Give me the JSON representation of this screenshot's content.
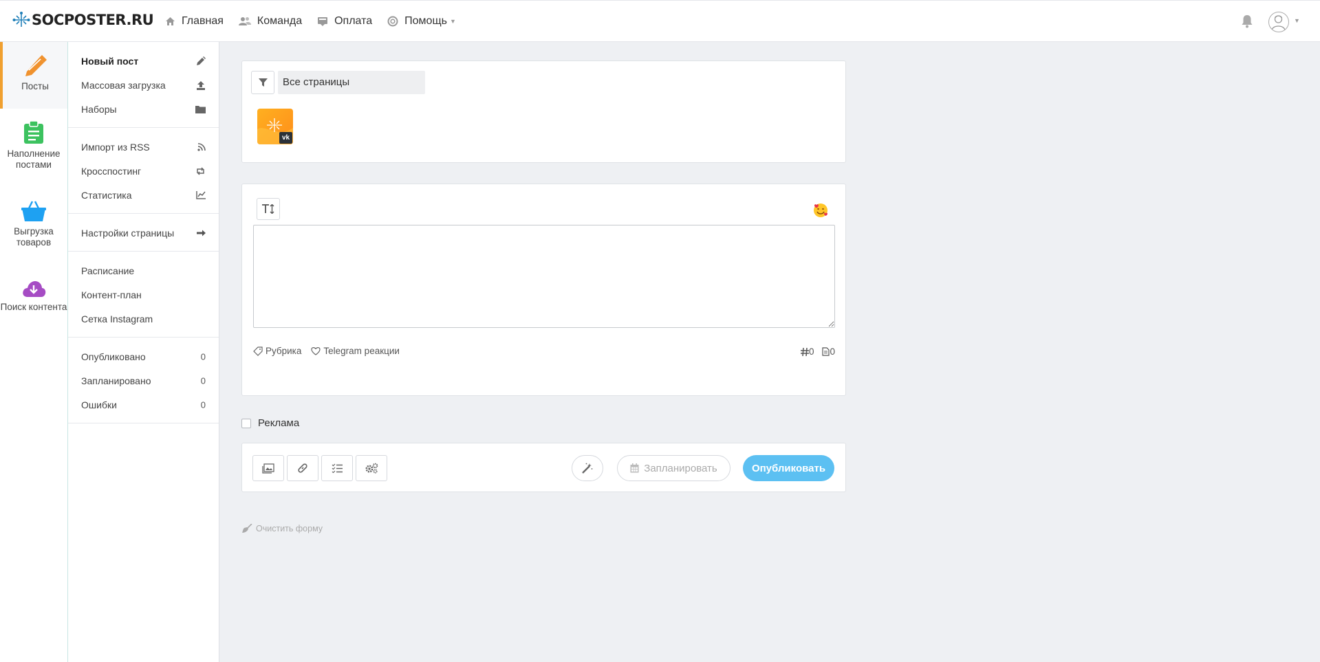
{
  "brand": {
    "name": "SOCPOSTER.RU"
  },
  "nav": [
    {
      "label": "Главная",
      "icon": "home-icon"
    },
    {
      "label": "Команда",
      "icon": "team-icon"
    },
    {
      "label": "Оплата",
      "icon": "payment-icon"
    },
    {
      "label": "Помощь",
      "icon": "help-icon"
    }
  ],
  "iconbar": [
    {
      "label": "Посты",
      "icon": "pencil-icon",
      "color": "#f0922e"
    },
    {
      "label": "Наполнение постами",
      "icon": "clipboard-icon",
      "color": "#3cc25f"
    },
    {
      "label": "Выгрузка товаров",
      "icon": "basket-icon",
      "color": "#1ea1f2"
    },
    {
      "label": "Поиск контента",
      "icon": "cloud-download-icon",
      "color": "#a64cc4"
    }
  ],
  "submenu": {
    "new_post": "Новый пост",
    "bulk_upload": "Массовая загрузка",
    "sets": "Наборы",
    "rss_import": "Импорт из RSS",
    "crossposting": "Кросспостинг",
    "stats": "Статистика",
    "page_settings": "Настройки страницы",
    "schedule": "Расписание",
    "content_plan": "Контент-план",
    "instagram_grid": "Сетка Instagram",
    "published": {
      "label": "Опубликовано",
      "count": "0"
    },
    "scheduled": {
      "label": "Запланировано",
      "count": "0"
    },
    "errors": {
      "label": "Ошибки",
      "count": "0"
    }
  },
  "pages": {
    "filter_value": "Все страницы"
  },
  "editor": {
    "text_value": "",
    "rubric": "Рубрика",
    "telegram_reactions": "Telegram реакции",
    "hashtag_count": "0",
    "doc_count": "0"
  },
  "ad_label": "Реклама",
  "actions": {
    "schedule": "Запланировать",
    "publish": "Опубликовать"
  },
  "clear_form": "Очистить форму"
}
